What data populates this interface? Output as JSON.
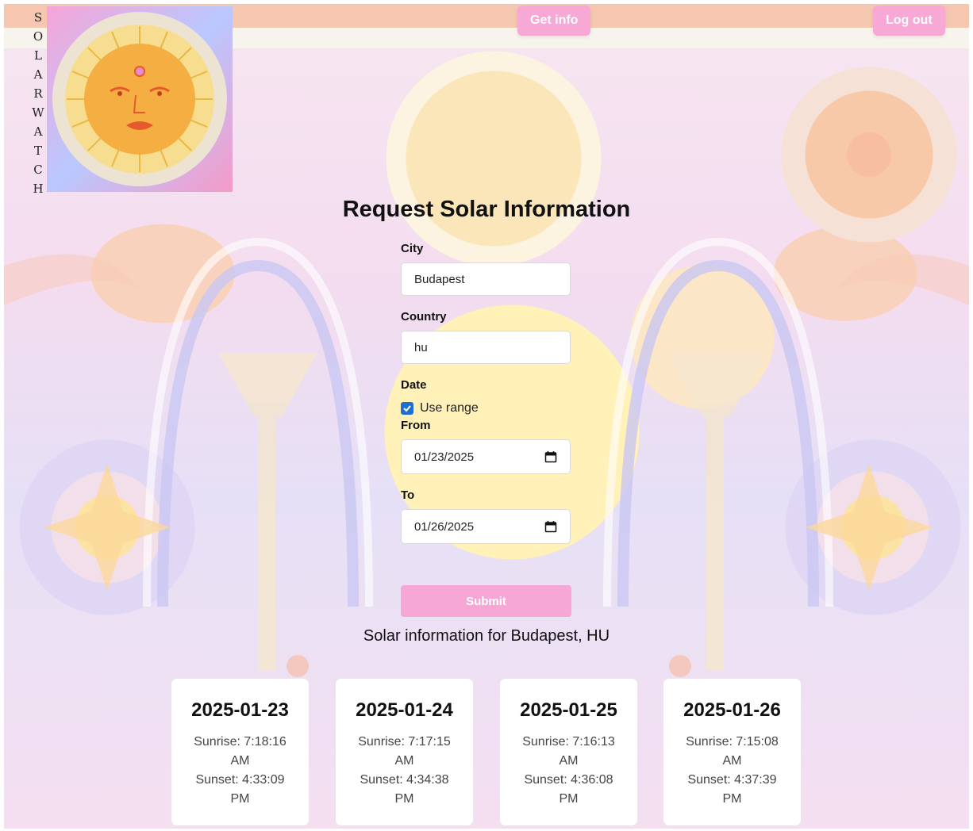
{
  "brand": {
    "letters": [
      "S",
      "O",
      "L",
      "A",
      "R",
      "W",
      "A",
      "T",
      "C",
      "H"
    ]
  },
  "nav": {
    "get_info": "Get info",
    "log_out": "Log out"
  },
  "form": {
    "title": "Request Solar Information",
    "city_label": "City",
    "city_value": "Budapest",
    "country_label": "Country",
    "country_value": "hu",
    "date_label": "Date",
    "use_range_label": "Use range",
    "use_range_checked": true,
    "from_label": "From",
    "from_value": "01/23/2025",
    "to_label": "To",
    "to_value": "01/26/2025",
    "submit_label": "Submit"
  },
  "results": {
    "title": "Solar information for Budapest, HU",
    "days": [
      {
        "date": "2025-01-23",
        "sunrise": "Sunrise: 7:18:16 AM",
        "sunset": "Sunset: 4:33:09 PM"
      },
      {
        "date": "2025-01-24",
        "sunrise": "Sunrise: 7:17:15 AM",
        "sunset": "Sunset: 4:34:38 PM"
      },
      {
        "date": "2025-01-25",
        "sunrise": "Sunrise: 7:16:13 AM",
        "sunset": "Sunset: 4:36:08 PM"
      },
      {
        "date": "2025-01-26",
        "sunrise": "Sunrise: 7:15:08 AM",
        "sunset": "Sunset: 4:37:39 PM"
      }
    ]
  },
  "colors": {
    "accent_pink": "#f7a8d4",
    "topbar": "#f5c6b0",
    "checkbox_blue": "#1f6fd1"
  },
  "icons": {
    "logo": "sun-face-logo",
    "calendar": "calendar-icon",
    "check": "checkmark-icon"
  }
}
